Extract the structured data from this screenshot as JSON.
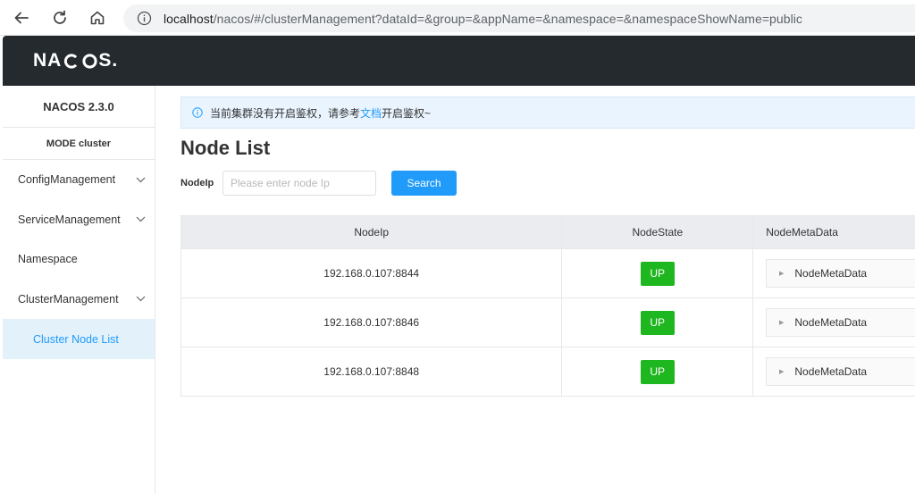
{
  "browser": {
    "url_host": "localhost",
    "url_path": "/nacos/#/clusterManagement?dataId=&group=&appName=&namespace=&namespaceShowName=public"
  },
  "header": {
    "logo_parts": [
      "NA",
      "C",
      "OS",
      "."
    ]
  },
  "sidebar": {
    "version": "NACOS 2.3.0",
    "mode": "MODE cluster",
    "items": [
      {
        "label": "ConfigManagement",
        "has_chevron": true
      },
      {
        "label": "ServiceManagement",
        "has_chevron": true
      },
      {
        "label": "Namespace",
        "has_chevron": false
      },
      {
        "label": "ClusterManagement",
        "has_chevron": true
      }
    ],
    "active_subitem": "Cluster Node List"
  },
  "main": {
    "notice": {
      "before": "当前集群没有开启鉴权，请参考",
      "link": "文档",
      "after": "开启鉴权~"
    },
    "title": "Node List",
    "search": {
      "label": "NodeIp",
      "placeholder": "Please enter node Ip",
      "value": "",
      "button": "Search"
    },
    "table": {
      "headers": [
        "NodeIp",
        "NodeState",
        "NodeMetaData"
      ],
      "rows": [
        {
          "ip": "192.168.0.107:8844",
          "state": "UP",
          "meta": "NodeMetaData"
        },
        {
          "ip": "192.168.0.107:8846",
          "state": "UP",
          "meta": "NodeMetaData"
        },
        {
          "ip": "192.168.0.107:8848",
          "state": "UP",
          "meta": "NodeMetaData"
        }
      ]
    }
  },
  "colors": {
    "accent": "#209bfa",
    "header_bg": "#252a2f",
    "status_up": "#1fb71f",
    "active_bg": "#e3f1fb"
  }
}
